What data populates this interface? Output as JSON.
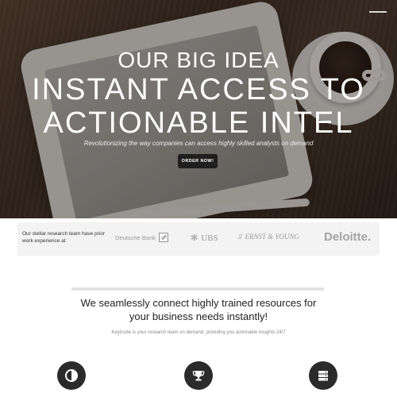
{
  "hero": {
    "kicker": "OUR BIG IDEA",
    "headline_line1": "INSTANT ACCESS TO",
    "headline_line2": "ACTIONABLE INTEL",
    "tagline": "Revolutionizing the way companies can access highly skilled analysts on demand",
    "cta_label": "ORDER NOW!"
  },
  "logos": {
    "intro": "Our stellar research team have prior work experience at",
    "items": [
      "Deutsche Bank",
      "UBS",
      "ERNST & YOUNG",
      "Deloitte."
    ]
  },
  "main": {
    "lead_line1": "We seamlessly connect highly trained resources for",
    "lead_line2": "your business needs instantly!",
    "sub": "KeyInsite is your research team on demand, providing you actionable insights 24/7"
  },
  "features": {
    "icons": [
      "contrast-icon",
      "trophy-icon",
      "server-icon"
    ]
  },
  "colors": {
    "button_bg": "#1f1f1f",
    "icon_circle": "#2b2b2b",
    "logo_gray": "#9a9a9a"
  }
}
